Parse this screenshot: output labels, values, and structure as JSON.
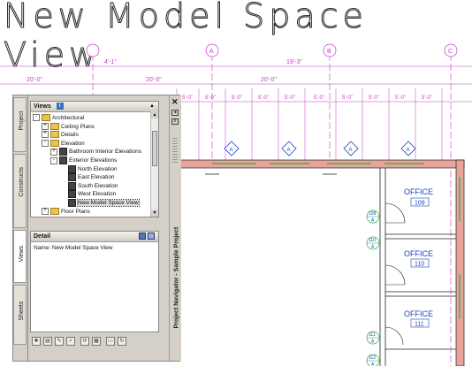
{
  "cad": {
    "title": "New Model Space View",
    "grid_labels": [
      "A",
      "B",
      "C"
    ],
    "overall_dim": "19'-3\"",
    "top_dims": [
      "20'-0\"",
      "4'-1\"",
      "20'-0\"",
      "20'-0\""
    ],
    "small_dims": [
      "5'-0\"",
      "5'-0\"",
      "5'-0\"",
      "5'-0\"",
      "5'-0\"",
      "5'-0\"",
      "5'-0\"",
      "5'-0\"",
      "5'-0\"",
      "5'-0\""
    ],
    "tag_letter": "A",
    "offices": [
      {
        "name": "OFFICE",
        "number": "109"
      },
      {
        "name": "OFFICE",
        "number": "110"
      },
      {
        "name": "OFFICE",
        "number": "111"
      }
    ],
    "door_tags": [
      {
        "num": "109",
        "letter": "A"
      },
      {
        "num": "110",
        "letter": "A"
      },
      {
        "num": "111",
        "letter": "A"
      },
      {
        "num": "112",
        "letter": "A"
      }
    ],
    "colors": {
      "dim": "#c83dc8",
      "wall_fill": "#e8a49b",
      "door": "#19b54b",
      "tag": "#1a3fbf"
    }
  },
  "palette": {
    "title": "Project Navigator - Sample Project",
    "side_tabs": [
      "Project",
      "Constructs",
      "Views",
      "Sheets"
    ],
    "active_tab": "Views",
    "views": {
      "header": "Views",
      "tree": [
        {
          "label": "Architectural",
          "level": 0,
          "icon": "folder",
          "exp": "-"
        },
        {
          "label": "Ceiling Plans",
          "level": 1,
          "icon": "folder",
          "exp": "+"
        },
        {
          "label": "Details",
          "level": 1,
          "icon": "folder",
          "exp": "+"
        },
        {
          "label": "Elevation",
          "level": 1,
          "icon": "folder",
          "exp": "-"
        },
        {
          "label": "Bathroom Interior Elevations",
          "level": 2,
          "icon": "view",
          "exp": "+"
        },
        {
          "label": "Exterior Elevations",
          "level": 2,
          "icon": "view",
          "exp": "-"
        },
        {
          "label": "North Elevation",
          "level": 3,
          "icon": "view",
          "exp": ""
        },
        {
          "label": "East Elevation",
          "level": 3,
          "icon": "view",
          "exp": ""
        },
        {
          "label": "South Elevation",
          "level": 3,
          "icon": "view",
          "exp": ""
        },
        {
          "label": "West Elevation",
          "level": 3,
          "icon": "view",
          "exp": ""
        },
        {
          "label": "New Model Space View",
          "level": 3,
          "icon": "view",
          "exp": "",
          "selected": true
        },
        {
          "label": "Floor Plans",
          "level": 1,
          "icon": "folder",
          "exp": "+"
        }
      ]
    },
    "detail": {
      "header": "Detail",
      "name_label": "Name:",
      "name_value": "New Model Space View"
    },
    "toolbar_icons": [
      "add-view-icon",
      "add-sheet-icon",
      "edit-icon",
      "check-icon",
      "regenerate-icon",
      "properties-icon",
      "open-icon",
      "refresh-icon"
    ]
  }
}
